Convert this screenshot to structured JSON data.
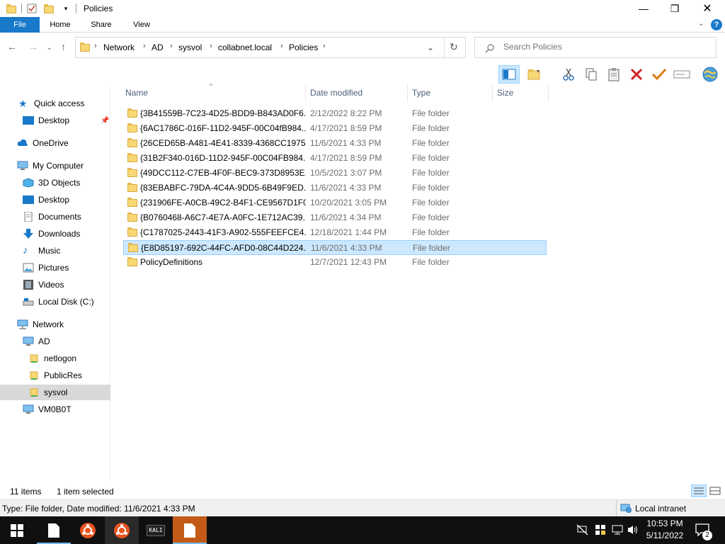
{
  "window": {
    "title": "Policies"
  },
  "ribbon": {
    "tabs": [
      "File",
      "Home",
      "Share",
      "View"
    ]
  },
  "address": {
    "crumbs": [
      "Network",
      "AD",
      "sysvol",
      "collabnet.local",
      "Policies"
    ]
  },
  "search": {
    "placeholder": "Search Policies"
  },
  "nav": {
    "quick_access": "Quick access",
    "desktop_pinned": "Desktop",
    "onedrive": "OneDrive",
    "my_computer": "My Computer",
    "objects3d": "3D Objects",
    "desktop": "Desktop",
    "documents": "Documents",
    "downloads": "Downloads",
    "music": "Music",
    "pictures": "Pictures",
    "videos": "Videos",
    "local_disk": "Local Disk (C:)",
    "network": "Network",
    "ad": "AD",
    "netlogon": "netlogon",
    "publicres": "PublicRes",
    "sysvol": "sysvol",
    "vm": "VM0B0T"
  },
  "columns": {
    "name": "Name",
    "date": "Date modified",
    "type": "Type",
    "size": "Size"
  },
  "files": [
    {
      "name": "{3B41559B-7C23-4D25-BDD9-B843AD0F6...",
      "date": "2/12/2022 8:22 PM",
      "type": "File folder"
    },
    {
      "name": "{6AC1786C-016F-11D2-945F-00C04fB984...",
      "date": "4/17/2021 8:59 PM",
      "type": "File folder"
    },
    {
      "name": "{26CED65B-A481-4E41-8339-4368CC1975...",
      "date": "11/6/2021 4:33 PM",
      "type": "File folder"
    },
    {
      "name": "{31B2F340-016D-11D2-945F-00C04FB984...",
      "date": "4/17/2021 8:59 PM",
      "type": "File folder"
    },
    {
      "name": "{49DCC112-C7EB-4F0F-BEC9-373D8953E...",
      "date": "10/5/2021 3:07 PM",
      "type": "File folder"
    },
    {
      "name": "{83EBABFC-79DA-4C4A-9DD5-6B49F9ED...",
      "date": "11/6/2021 4:33 PM",
      "type": "File folder"
    },
    {
      "name": "{231906FE-A0CB-49C2-B4F1-CE9567D1F0...",
      "date": "10/20/2021 3:05 PM",
      "type": "File folder"
    },
    {
      "name": "{B0760468-A6C7-4E7A-A0FC-1E712AC39...",
      "date": "11/6/2021 4:34 PM",
      "type": "File folder"
    },
    {
      "name": "{C1787025-2443-41F3-A902-555FEEFCE4...",
      "date": "12/18/2021 1:44 PM",
      "type": "File folder"
    },
    {
      "name": "{E8D85197-692C-44FC-AFD0-08C44D224...",
      "date": "11/6/2021 4:33 PM",
      "type": "File folder"
    },
    {
      "name": "PolicyDefinitions",
      "date": "12/7/2021 12:43 PM",
      "type": "File folder"
    }
  ],
  "status": {
    "items": "11 items",
    "selected": "1 item selected"
  },
  "details": {
    "text": "Type: File folder, Date modified: 11/6/2021 4:33 PM",
    "zone": "Local intranet"
  },
  "taskbar": {
    "kali_label": "KALI",
    "time": "10:53 PM",
    "date": "5/11/2022",
    "notif_count": "2"
  },
  "colors": {
    "accent": "#1979ca",
    "selection": "#cce8ff",
    "folder": "#f8d775"
  }
}
